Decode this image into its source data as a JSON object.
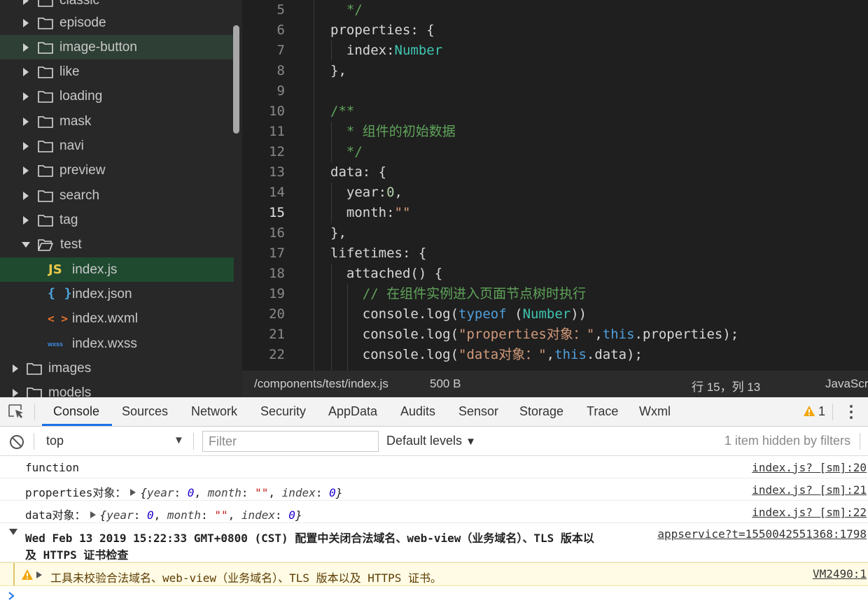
{
  "file_tree": {
    "items": [
      {
        "label": "classic",
        "type": "folder",
        "open": false,
        "depth": 1
      },
      {
        "label": "episode",
        "type": "folder",
        "open": false,
        "depth": 1
      },
      {
        "label": "image-button",
        "type": "folder",
        "open": false,
        "depth": 1
      },
      {
        "label": "like",
        "type": "folder",
        "open": false,
        "depth": 1
      },
      {
        "label": "loading",
        "type": "folder",
        "open": false,
        "depth": 1
      },
      {
        "label": "mask",
        "type": "folder",
        "open": false,
        "depth": 1
      },
      {
        "label": "navi",
        "type": "folder",
        "open": false,
        "depth": 1
      },
      {
        "label": "preview",
        "type": "folder",
        "open": false,
        "depth": 1
      },
      {
        "label": "search",
        "type": "folder",
        "open": false,
        "depth": 1
      },
      {
        "label": "tag",
        "type": "folder",
        "open": false,
        "depth": 1
      },
      {
        "label": "test",
        "type": "folder",
        "open": true,
        "depth": 1
      },
      {
        "label": "index.js",
        "type": "file",
        "icon": "JS",
        "depth": 2
      },
      {
        "label": "index.json",
        "type": "file",
        "icon": "{ }",
        "depth": 2
      },
      {
        "label": "index.wxml",
        "type": "file",
        "icon": "< >",
        "depth": 2
      },
      {
        "label": "index.wxss",
        "type": "file",
        "icon": "wxss",
        "depth": 2
      },
      {
        "label": "images",
        "type": "folder",
        "open": false,
        "depth": 0
      },
      {
        "label": "models",
        "type": "folder",
        "open": false,
        "depth": 0
      }
    ]
  },
  "editor": {
    "line_numbers": [
      "5",
      "6",
      "7",
      "8",
      "9",
      "10",
      "11",
      "12",
      "13",
      "14",
      "15",
      "16",
      "17",
      "18",
      "19",
      "20",
      "21",
      "22"
    ],
    "current_line": "15"
  },
  "status_bar": {
    "path": "/components/test/index.js",
    "size": "500 B",
    "position": "行 15，列 13",
    "language": "JavaScript"
  },
  "devtools": {
    "tabs": [
      "Console",
      "Sources",
      "Network",
      "Security",
      "AppData",
      "Audits",
      "Sensor",
      "Storage",
      "Trace",
      "Wxml"
    ],
    "active_tab": "Console",
    "warning_count": "1"
  },
  "console_toolbar": {
    "context": "top",
    "filter_placeholder": "Filter",
    "levels": "Default levels",
    "hidden_note": "1 item hidden by filters"
  },
  "console": {
    "messages": [
      {
        "text": "function",
        "source": "index.js? [sm]:20"
      },
      {
        "label": "properties对象：",
        "source": "index.js? [sm]:21"
      },
      {
        "label": "data对象：",
        "source": "index.js? [sm]:22"
      },
      {
        "text_line1": "Wed Feb 13 2019 15:22:33 GMT+0800 (CST) 配置中关闭合法域名、web-view（业务域名）、TLS 版本以",
        "text_line2": "及 HTTPS 证书检查",
        "source": "appservice?t=1550042551368:1798"
      },
      {
        "text": "工具未校验合法域名、web-view（业务域名）、TLS 版本以及 HTTPS 证书。",
        "source": "VM2490:1"
      }
    ]
  },
  "colors": {
    "tree_bg": "#282828",
    "editor_bg": "#1f1f1f",
    "selected_row": "#1f4a30",
    "active_tab_underline": "#1a73e8",
    "warning_bg": "#fffbe5"
  }
}
